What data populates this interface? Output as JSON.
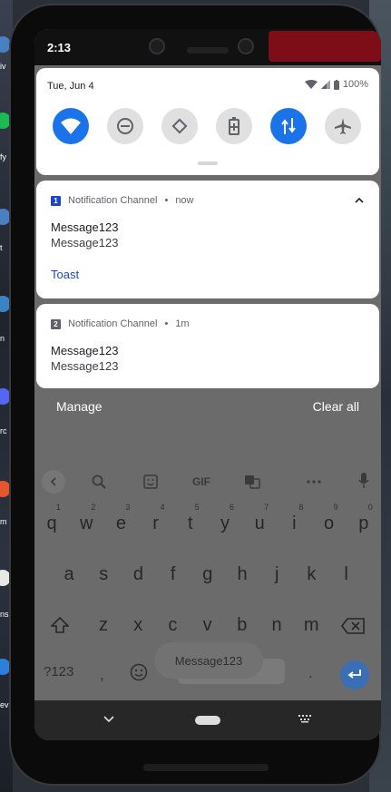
{
  "desktop": {
    "labels": [
      "iv",
      "fy",
      "t",
      "n",
      "rc",
      "m",
      "ns",
      "ev"
    ]
  },
  "status_bar": {
    "time": "2:13"
  },
  "quick_settings": {
    "date": "Tue, Jun 4",
    "battery": "100%",
    "tiles": [
      {
        "name": "wifi",
        "active": true
      },
      {
        "name": "do-not-disturb",
        "active": false
      },
      {
        "name": "auto-rotate",
        "active": false
      },
      {
        "name": "battery-saver",
        "active": false
      },
      {
        "name": "mobile-data",
        "active": true
      },
      {
        "name": "airplane-mode",
        "active": false
      }
    ]
  },
  "notifications": [
    {
      "app_badge": "1",
      "channel": "Notification Channel",
      "separator": "•",
      "time": "now",
      "title": "Message123",
      "text": "Message123",
      "action": "Toast",
      "badge_color": "#1a47c9"
    },
    {
      "app_badge": "2",
      "channel": "Notification Channel",
      "separator": "•",
      "time": "1m",
      "title": "Message123",
      "text": "Message123",
      "badge_color": "#5f6368"
    }
  ],
  "shade_footer": {
    "manage": "Manage",
    "clear_all": "Clear all"
  },
  "keyboard": {
    "toolbar_gif": "GIF",
    "row1": [
      "q",
      "w",
      "e",
      "r",
      "t",
      "y",
      "u",
      "i",
      "o",
      "p"
    ],
    "row1_hints": [
      "1",
      "2",
      "3",
      "4",
      "5",
      "6",
      "7",
      "8",
      "9",
      "0"
    ],
    "row2": [
      "a",
      "s",
      "d",
      "f",
      "g",
      "h",
      "j",
      "k",
      "l"
    ],
    "row3": [
      "z",
      "x",
      "c",
      "v",
      "b",
      "n",
      "m"
    ],
    "symbols": "?123",
    "comma": ",",
    "period": ".",
    "suggestion": "Message123"
  },
  "colors": {
    "accent": "#1a73e8",
    "scrim": "#6b6b6b",
    "action_link": "#1a47c9"
  }
}
